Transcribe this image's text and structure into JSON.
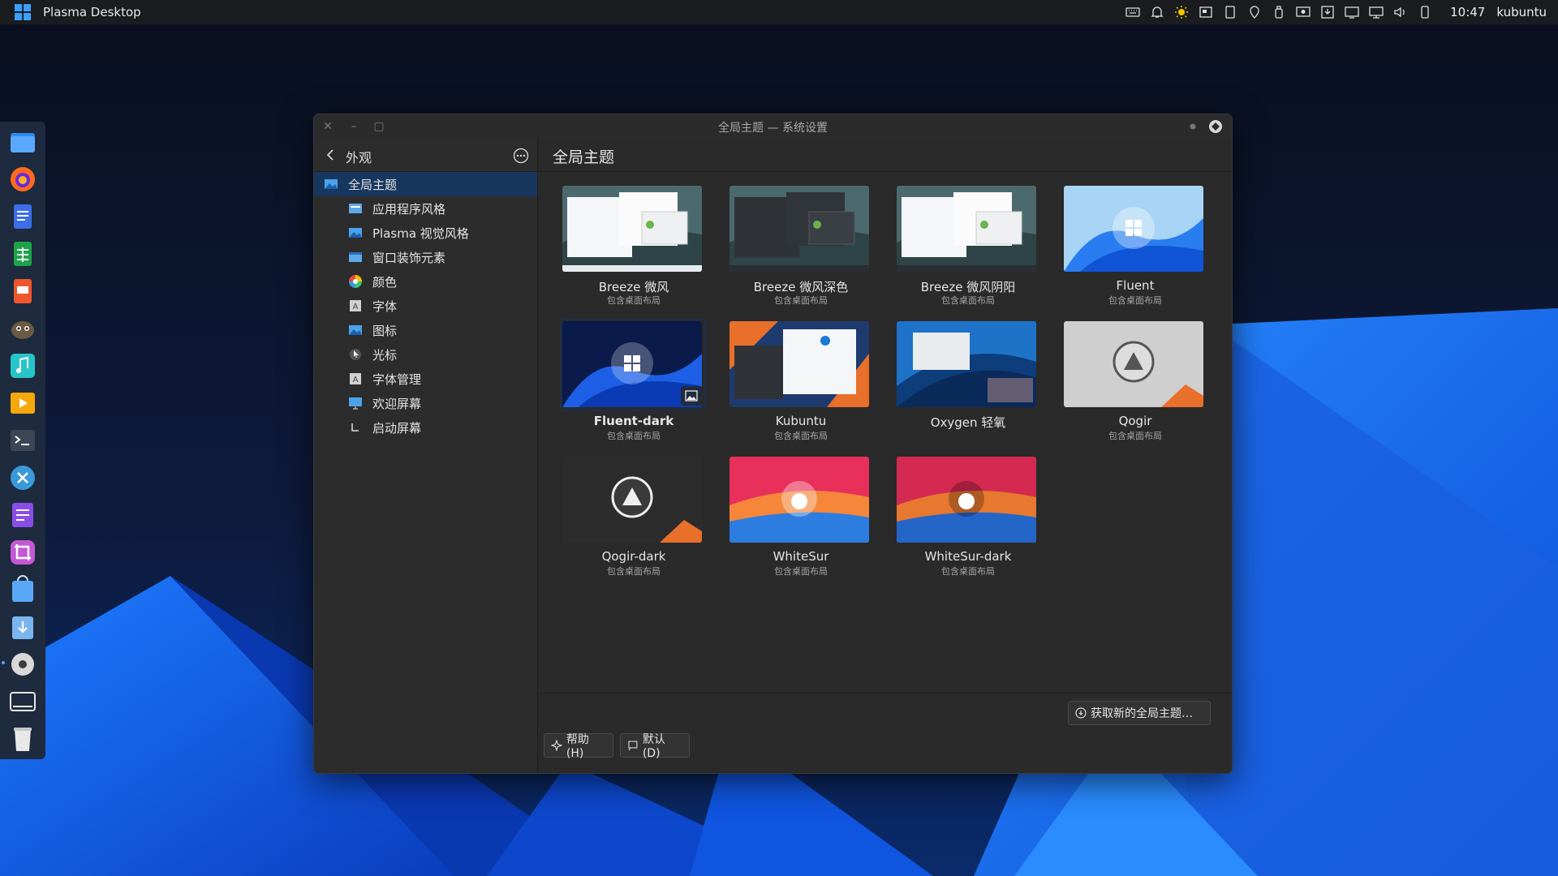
{
  "topbar": {
    "app_title": "Plasma Desktop",
    "clock": "10:47",
    "username": "kubuntu",
    "tray_icons": [
      "keyboard-icon",
      "notification-bell-icon",
      "brightness-icon",
      "clipboard-icon",
      "device-icon",
      "location-pin-icon",
      "usb-icon",
      "screen-share-icon",
      "download-icon",
      "display-config-icon",
      "monitor-icon",
      "volume-icon",
      "battery-icon"
    ]
  },
  "dock": {
    "items": [
      "file-manager-icon",
      "firefox-icon",
      "writer-icon",
      "calc-icon",
      "impress-icon",
      "gimp-icon",
      "music-icon",
      "video-player-icon",
      "terminal-icon",
      "kde-connect-icon",
      "notes-icon",
      "screenshot-icon",
      "store-icon",
      "download-manager-icon",
      "settings-icon",
      "desktop-switcher-icon",
      "trash-icon"
    ],
    "active_item": "settings-icon"
  },
  "window": {
    "title": "全局主题 — 系统设置",
    "sidebar": {
      "back_label": "外观",
      "items": [
        {
          "label": "全局主题",
          "icon": "global-theme-icon",
          "active": true
        },
        {
          "label": "应用程序风格",
          "icon": "app-style-icon",
          "active": false
        },
        {
          "label": "Plasma 视觉风格",
          "icon": "plasma-style-icon",
          "active": false
        },
        {
          "label": "窗口装饰元素",
          "icon": "window-decoration-icon",
          "active": false
        },
        {
          "label": "颜色",
          "icon": "color-icon",
          "active": false
        },
        {
          "label": "字体",
          "icon": "font-icon",
          "active": false
        },
        {
          "label": "图标",
          "icon": "icons-icon",
          "active": false
        },
        {
          "label": "光标",
          "icon": "cursor-icon",
          "active": false
        },
        {
          "label": "字体管理",
          "icon": "font-manager-icon",
          "active": false
        },
        {
          "label": "欢迎屏幕",
          "icon": "splash-screen-icon",
          "active": false
        },
        {
          "label": "启动屏幕",
          "icon": "boot-screen-icon",
          "active": false
        }
      ]
    },
    "content": {
      "page_title": "全局主题",
      "themes": [
        {
          "name": "Breeze 微风",
          "subtitle": "包含桌面布局",
          "preview": "breeze-light"
        },
        {
          "name": "Breeze 微风深色",
          "subtitle": "包含桌面布局",
          "preview": "breeze-dark"
        },
        {
          "name": "Breeze 微风阴阳",
          "subtitle": "包含桌面布局",
          "preview": "breeze-twilight"
        },
        {
          "name": "Fluent",
          "subtitle": "包含桌面布局",
          "preview": "fluent"
        },
        {
          "name": "Fluent-dark",
          "subtitle": "包含桌面布局",
          "preview": "fluent-dark",
          "selected": true
        },
        {
          "name": "Kubuntu",
          "subtitle": "包含桌面布局",
          "preview": "kubuntu"
        },
        {
          "name": "Oxygen 轻氧",
          "subtitle": "",
          "preview": "oxygen"
        },
        {
          "name": "Qogir",
          "subtitle": "包含桌面布局",
          "preview": "qogir"
        },
        {
          "name": "Qogir-dark",
          "subtitle": "包含桌面布局",
          "preview": "qogir-dark"
        },
        {
          "name": "WhiteSur",
          "subtitle": "包含桌面布局",
          "preview": "whitesur"
        },
        {
          "name": "WhiteSur-dark",
          "subtitle": "包含桌面布局",
          "preview": "whitesur-dark"
        }
      ],
      "get_new_label": "获取新的全局主题…",
      "help_label": "帮助(H)",
      "defaults_label": "默认(D)"
    }
  },
  "colors": {
    "accent": "#17375e",
    "wallpaper_blue": "#1565e8",
    "panel": "#1b1c1f"
  }
}
